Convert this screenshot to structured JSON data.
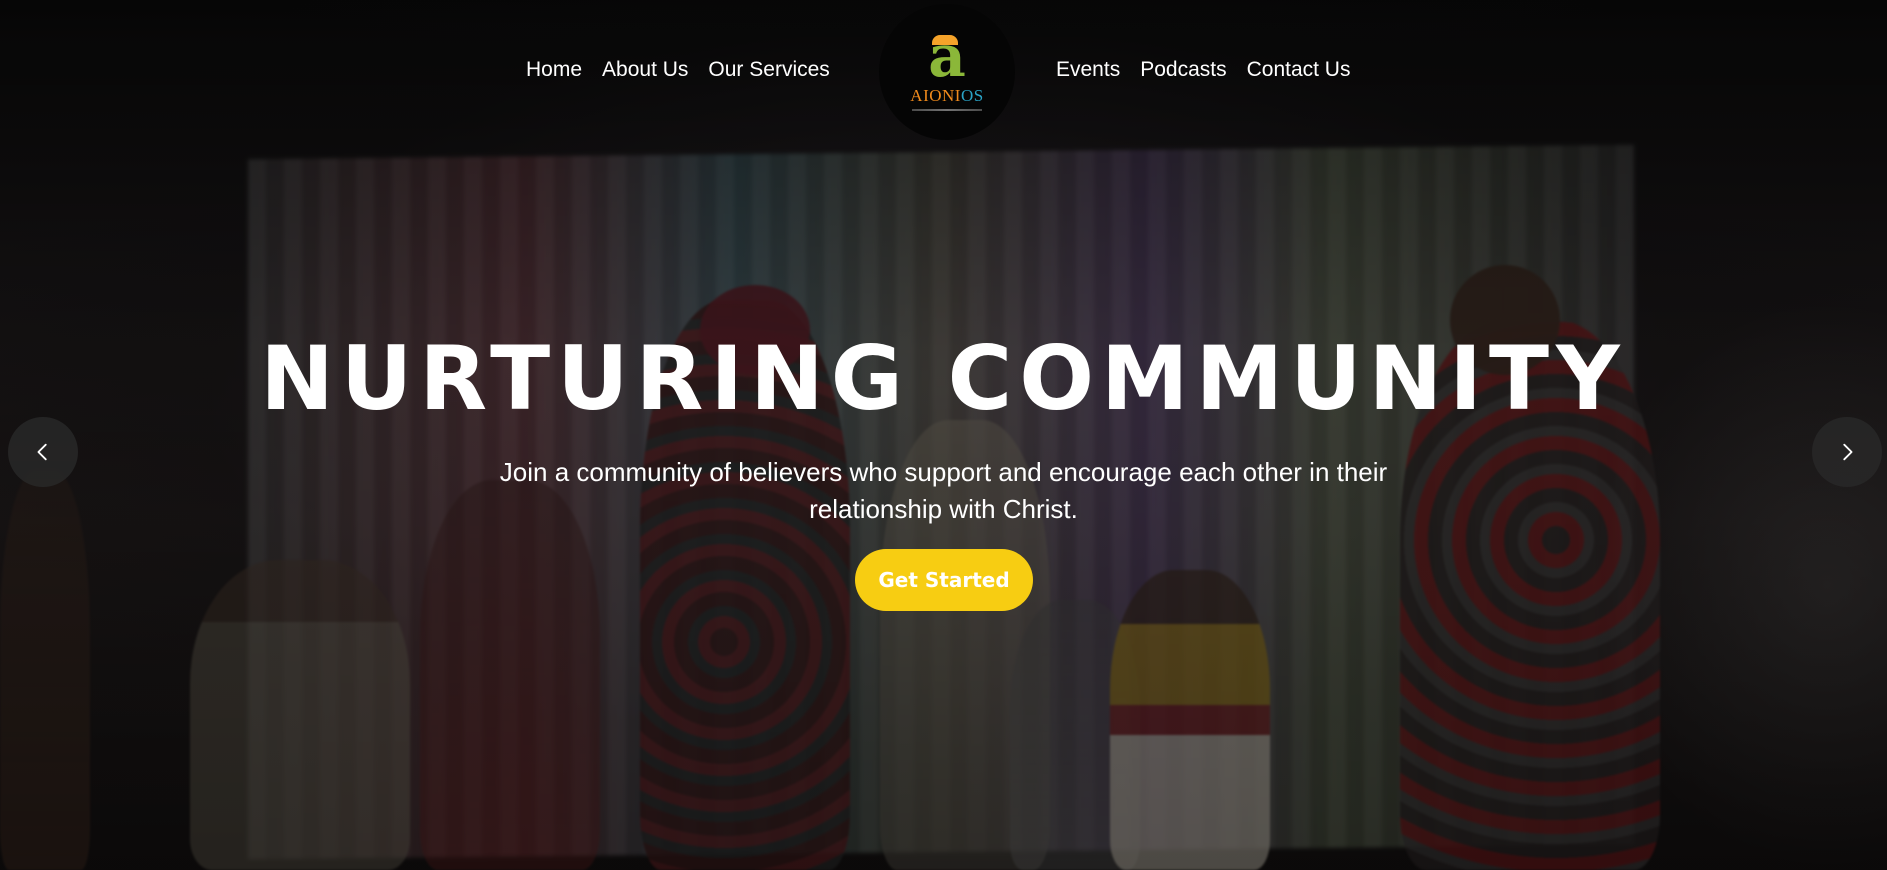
{
  "nav": {
    "left": [
      {
        "label": "Home"
      },
      {
        "label": "About Us"
      },
      {
        "label": "Our Services"
      }
    ],
    "right": [
      {
        "label": "Events"
      },
      {
        "label": "Podcasts"
      },
      {
        "label": "Contact Us"
      }
    ]
  },
  "logo": {
    "mark": "a",
    "word_part1": "AIONI",
    "word_part2": "OS"
  },
  "hero": {
    "headline": "NURTURING COMMUNITY",
    "subtext": "Join a community of believers who support and encourage each other in their relationship with Christ.",
    "cta_label": "Get Started"
  },
  "carousel": {
    "prev_icon": "chevron-left-icon",
    "next_icon": "chevron-right-icon"
  },
  "colors": {
    "accent": "#f7cd12",
    "logo_green": "#8bb739",
    "logo_orange": "#f08a1c",
    "logo_teal": "#2aa4c7"
  }
}
